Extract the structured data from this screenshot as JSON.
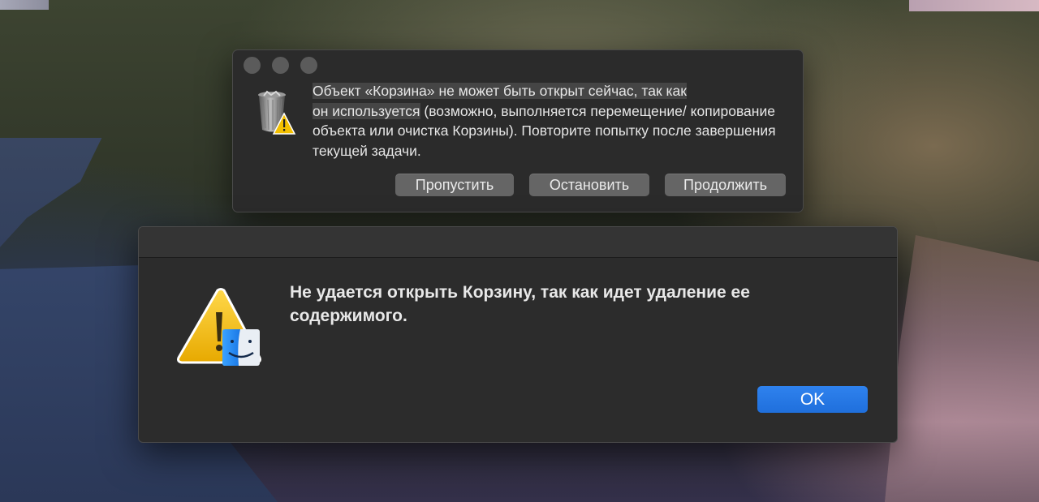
{
  "dialog1": {
    "message_selected_1": "Объект «Корзина» не может быть открыт сейчас, так как",
    "message_selected_2": "он используется",
    "message_rest": " (возможно, выполняется перемещение/ копирование объекта или очистка Корзины). Повторите попытку после завершения текущей задачи.",
    "buttons": {
      "skip": "Пропустить",
      "stop": "Остановить",
      "continue": "Продолжить"
    },
    "icon": "trash-warning-icon"
  },
  "dialog2": {
    "message": "Не удается открыть Корзину, так как идет удаление ее содержимого.",
    "ok_label": "OK",
    "icon": "warning-finder-icon"
  },
  "colors": {
    "dialog_bg": "#2b2b2b",
    "button_bg": "#656565",
    "accent_blue": "#2a7ae8",
    "warning_yellow": "#f5c400"
  }
}
